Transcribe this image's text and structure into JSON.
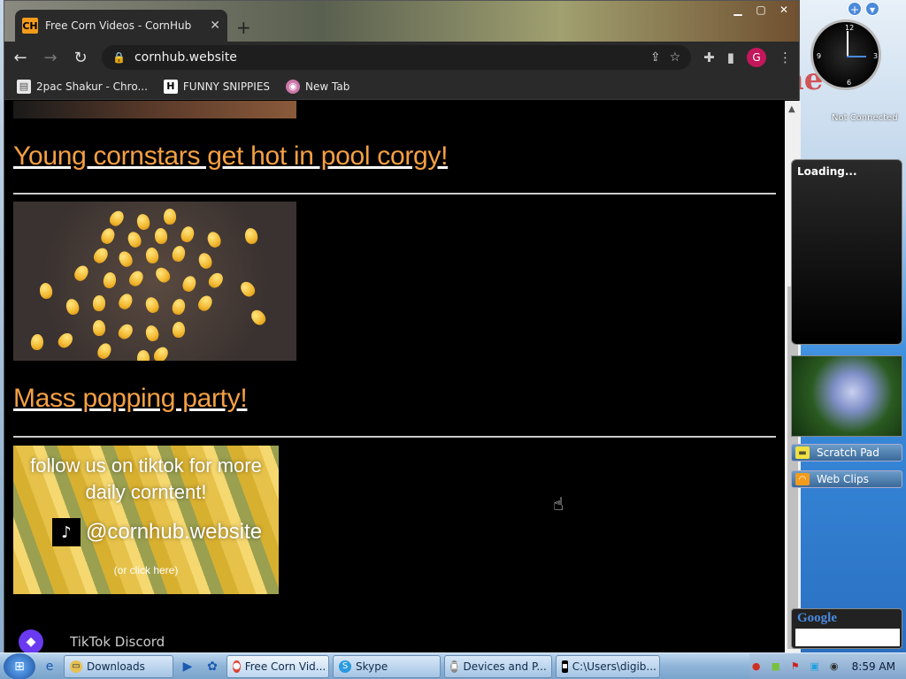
{
  "browser": {
    "tab_title": "Free Corn Videos - CornHub",
    "tab_favicon": "CH",
    "url": "cornhub.website",
    "profile_initial": "G"
  },
  "bookmarks": [
    {
      "label": "2pac Shakur - Chro...",
      "icon": "page-icon"
    },
    {
      "label": "FUNNY SNIPPIES",
      "icon": "h-icon"
    },
    {
      "label": "New Tab",
      "icon": "globe-icon"
    }
  ],
  "page": {
    "post1_title": "Young cornstars get hot in pool corgy!",
    "post2_title": "Mass popping party!",
    "promo": {
      "line1": "follow us on tiktok for more",
      "line2": "daily corntent!",
      "handle": "@cornhub.website",
      "click": "(or click here)"
    },
    "footer_text": "TikTok Discord"
  },
  "gadgets": {
    "clock_status": "Not Connected",
    "loading": "Loading...",
    "scratch_pad": "Scratch Pad",
    "web_clips": "Web Clips",
    "google": "Google"
  },
  "taskbar": {
    "items": [
      {
        "label": "Downloads",
        "icon": "folder-icon"
      },
      {
        "label": "Free Corn Vid...",
        "icon": "chrome-icon"
      },
      {
        "label": "Skype",
        "icon": "skype-icon"
      },
      {
        "label": "Devices and P...",
        "icon": "devices-icon"
      },
      {
        "label": "C:\\Users\\digib...",
        "icon": "cmd-icon"
      }
    ],
    "time": "8:59 AM"
  },
  "colors": {
    "link_orange": "#f5a043",
    "tab_bg": "#2a2a2a",
    "accent": "#f29b1d"
  }
}
